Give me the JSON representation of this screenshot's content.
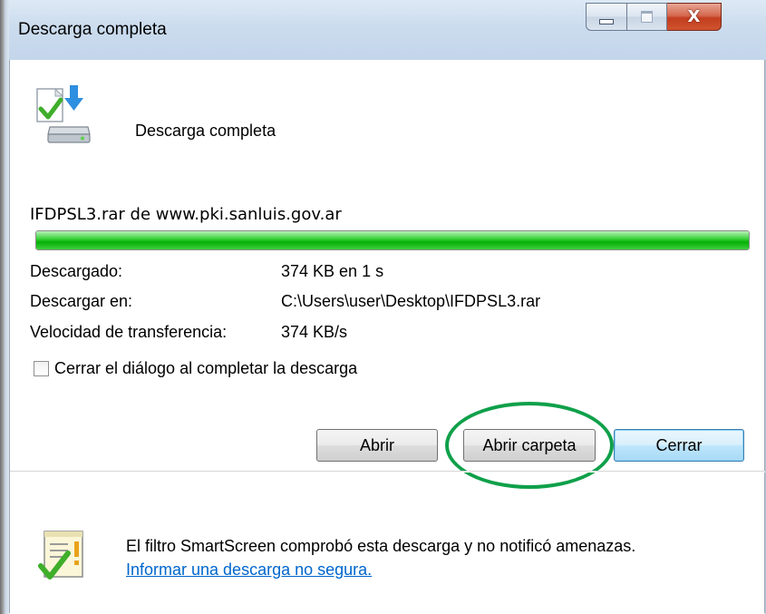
{
  "window": {
    "title": "Descarga completa",
    "controls": {
      "minimize_icon": "minimize-icon",
      "maximize_icon": "maximize-icon",
      "close_label": "X"
    }
  },
  "header": {
    "icon": "download-complete-icon",
    "text": "Descarga completa"
  },
  "download": {
    "filename_source": "IFDPSL3.rar de www.pki.sanluis.gov.ar",
    "progress": 1.0,
    "progress_color": "#06b006",
    "details": [
      {
        "label": "Descargado:",
        "value": "374 KB en 1 s"
      },
      {
        "label": "Descargar en:",
        "value": "C:\\Users\\user\\Desktop\\IFDPSL3.rar"
      },
      {
        "label": "Velocidad de transferencia:",
        "value": "374 KB/s"
      }
    ]
  },
  "options": {
    "close_on_complete_label": "Cerrar el diálogo al completar la descarga",
    "close_on_complete_checked": false
  },
  "buttons": {
    "open": "Abrir",
    "open_folder": "Abrir carpeta",
    "close": "Cerrar"
  },
  "annotation": {
    "highlight_color": "#0fa04a",
    "highlight_target": "open_folder"
  },
  "footer": {
    "icon": "smartscreen-check-icon",
    "message": "El filtro SmartScreen comprobó esta descarga y no notificó amenazas.",
    "report_link": "Informar una descarga no segura."
  }
}
